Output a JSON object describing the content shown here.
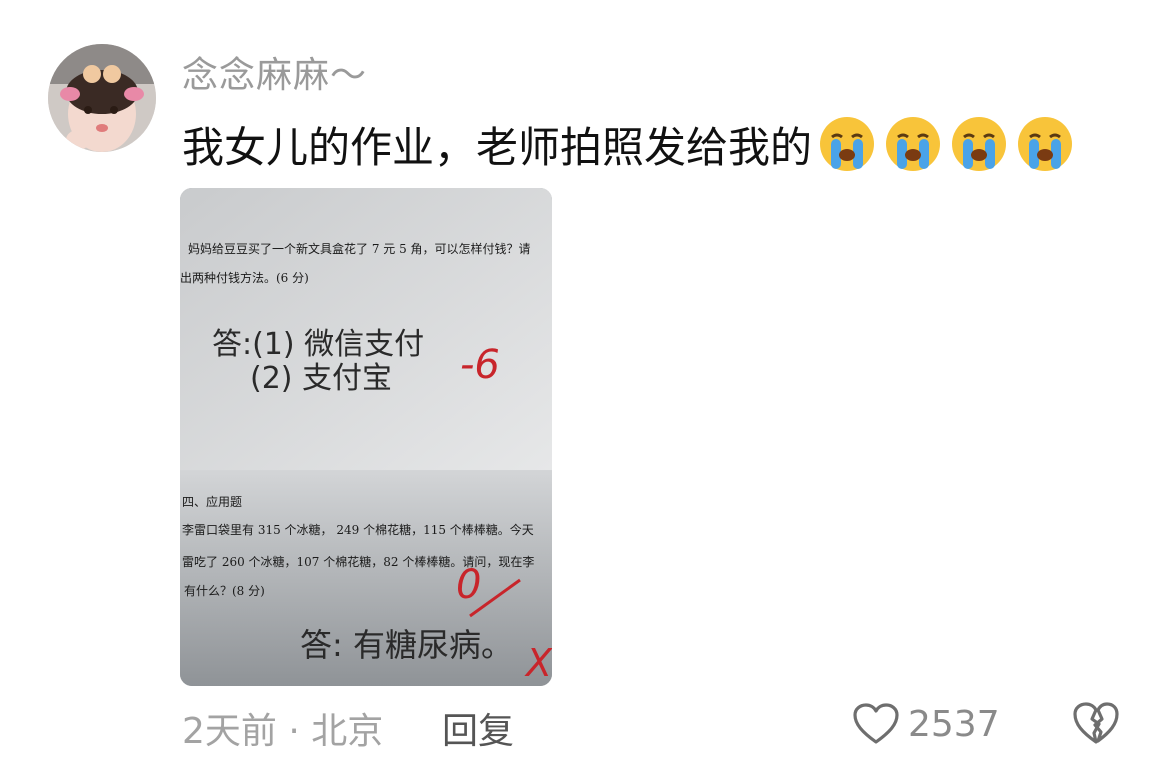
{
  "comment": {
    "username": "念念麻麻～",
    "text": "我女儿的作业，老师拍照发给我的",
    "emoji_name": "loudly-crying-face",
    "emoji_count": 4
  },
  "homework_photo": {
    "question1_line1": "妈妈给豆豆买了一个新文具盒花了 7 元 5 角，可以怎样付钱？请",
    "question1_line2": "出两种付钱方法。(6 分)",
    "answer1_line1": "答:(1) 微信支付",
    "answer1_line2": "(2) 支付宝",
    "grade1": "-6",
    "section_heading": "四、应用题",
    "question2_line1": "李雷口袋里有 315 个冰糖，  249  个棉花糖，115 个棒棒糖。今天",
    "question2_line2": "雷吃了 260 个冰糖，107 个棉花糖，82  个棒棒糖。请问，现在李",
    "question2_line3": "有什么？(8 分)",
    "grade2": "0",
    "answer2": "答: 有糖尿病。",
    "mark": "X"
  },
  "footer": {
    "meta": "2天前 · 北京",
    "reply_label": "回复",
    "like_count": "2537"
  },
  "colors": {
    "teacher_red": "#c8252b",
    "emoji_yellow": "#f8c43a",
    "tear_blue": "#4aa3e8"
  }
}
